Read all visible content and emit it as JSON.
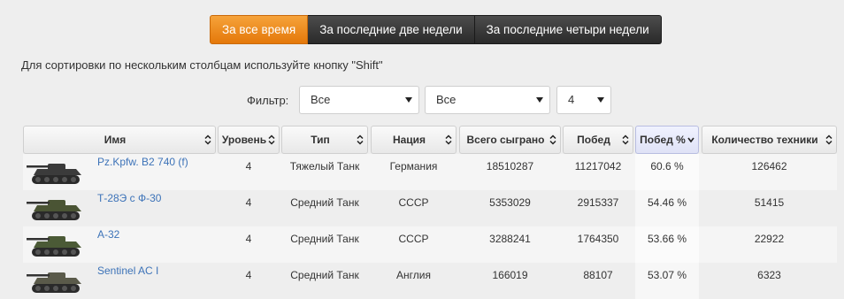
{
  "tabs": [
    {
      "label": "За все время",
      "active": true
    },
    {
      "label": "За последние две недели",
      "active": false
    },
    {
      "label": "За последние четыри недели",
      "active": false
    }
  ],
  "hint": "Для сортировки по нескольким столбцам используйте кнопку \"Shift\"",
  "filter": {
    "label": "Фильтр:",
    "selects": [
      {
        "value": "Все"
      },
      {
        "value": "Все"
      },
      {
        "value": "4"
      }
    ]
  },
  "table": {
    "columns": [
      {
        "label": "Имя"
      },
      {
        "label": "Уровень"
      },
      {
        "label": "Тип"
      },
      {
        "label": "Нация"
      },
      {
        "label": "Всего сыграно"
      },
      {
        "label": "Побед"
      },
      {
        "label": "Побед %",
        "sorted": "desc"
      },
      {
        "label": "Количество техники"
      }
    ],
    "rows": [
      {
        "name": "Pz.Kpfw. B2 740 (f)",
        "level": "4",
        "type": "Тяжелый Танк",
        "nation": "Германия",
        "played": "18510287",
        "wins": "11217042",
        "win_pct": "60.6 %",
        "count": "126462",
        "tank_color": "#3b3b3b"
      },
      {
        "name": "Т-28Э с Ф-30",
        "level": "4",
        "type": "Средний Танк",
        "nation": "СССР",
        "played": "5353029",
        "wins": "2915337",
        "win_pct": "54.46 %",
        "count": "51415",
        "tank_color": "#4a5434"
      },
      {
        "name": "А-32",
        "level": "4",
        "type": "Средний Танк",
        "nation": "СССР",
        "played": "3288241",
        "wins": "1764350",
        "win_pct": "53.66 %",
        "count": "22922",
        "tank_color": "#4b5a36"
      },
      {
        "name": "Sentinel AC I",
        "level": "4",
        "type": "Средний Танк",
        "nation": "Англия",
        "played": "166019",
        "wins": "88107",
        "win_pct": "53.07 %",
        "count": "6323",
        "tank_color": "#5a5a4a"
      }
    ]
  }
}
